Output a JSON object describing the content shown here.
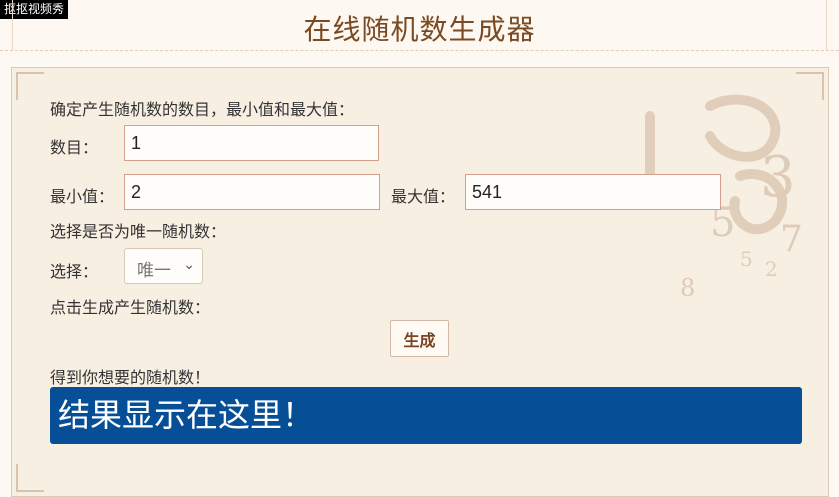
{
  "watermark": "抠抠视频秀",
  "page_title": "在线随机数生成器",
  "form": {
    "intro": "确定产生随机数的数目，最小值和最大值：",
    "count_label": "数目：",
    "count_value": "1",
    "min_label": "最小值：",
    "min_value": "2",
    "max_label": "最大值：",
    "max_value": "541",
    "unique_prompt": "选择是否为唯一随机数：",
    "choice_label": "选择：",
    "choice_value": "唯一",
    "generate_prompt": "点击生成产生随机数：",
    "generate_button": "生成",
    "result_prompt": "得到你想要的随机数！",
    "result_text": "结果显示在这里！"
  },
  "colors": {
    "title": "#7a4a22",
    "result_bg": "#064f96",
    "panel_bg": "#f8efe3",
    "field_border": "#d3a08d"
  }
}
